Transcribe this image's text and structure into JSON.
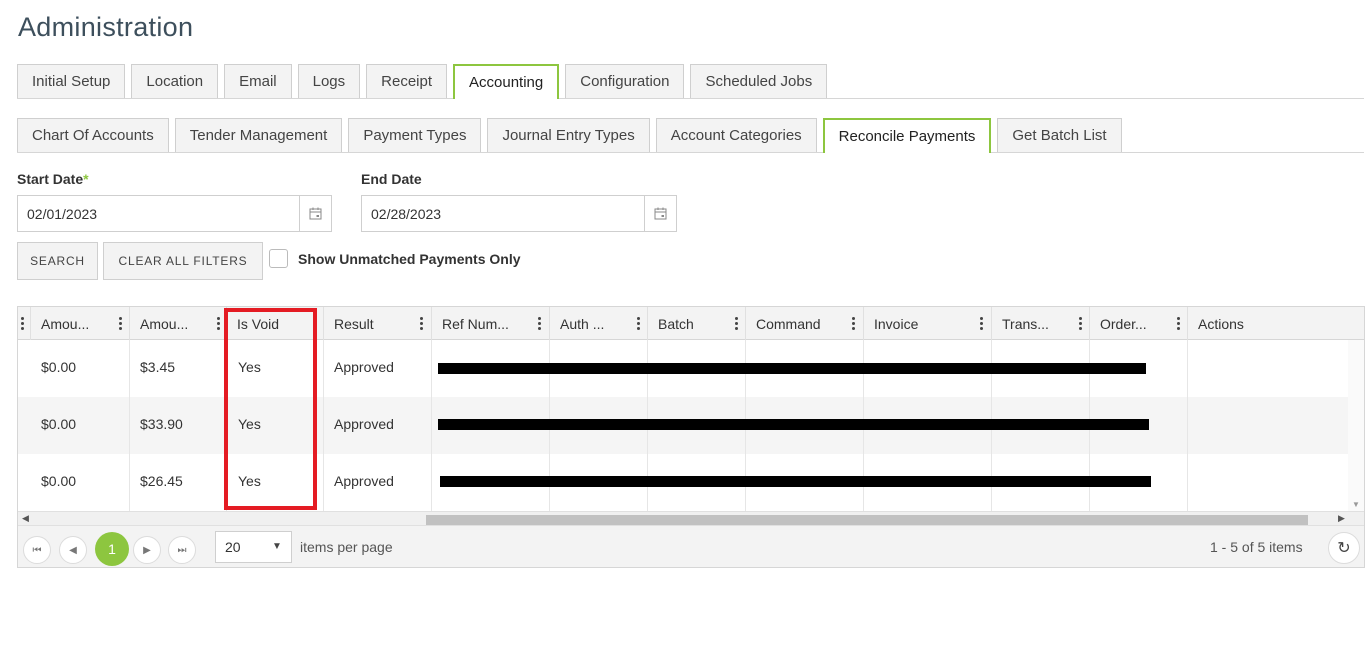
{
  "page": {
    "title": "Administration"
  },
  "main_tabs": [
    {
      "label": "Initial Setup",
      "active": false
    },
    {
      "label": "Location",
      "active": false
    },
    {
      "label": "Email",
      "active": false
    },
    {
      "label": "Logs",
      "active": false
    },
    {
      "label": "Receipt",
      "active": false
    },
    {
      "label": "Accounting",
      "active": true
    },
    {
      "label": "Configuration",
      "active": false
    },
    {
      "label": "Scheduled Jobs",
      "active": false
    }
  ],
  "sub_tabs": [
    {
      "label": "Chart Of Accounts",
      "active": false
    },
    {
      "label": "Tender Management",
      "active": false
    },
    {
      "label": "Payment Types",
      "active": false
    },
    {
      "label": "Journal Entry Types",
      "active": false
    },
    {
      "label": "Account Categories",
      "active": false
    },
    {
      "label": "Reconcile Payments",
      "active": true
    },
    {
      "label": "Get Batch List",
      "active": false
    }
  ],
  "filters": {
    "start_date_label": "Start Date",
    "start_required_mark": "*",
    "start_date_value": "02/01/2023",
    "end_date_label": "End Date",
    "end_date_value": "02/28/2023",
    "search_label": "SEARCH",
    "clear_label": "CLEAR ALL FILTERS",
    "unmatched_label": "Show Unmatched Payments Only",
    "unmatched_checked": false
  },
  "grid": {
    "columns": [
      "Amou...",
      "Amou...",
      "Is Void",
      "Result",
      "Ref Num...",
      "Auth ...",
      "Batch",
      "Command",
      "Invoice",
      "Trans...",
      "Order...",
      "Actions"
    ],
    "rows": [
      {
        "amount1": "$0.00",
        "amount2": "$3.45",
        "is_void": "Yes",
        "result": "Approved"
      },
      {
        "amount1": "$0.00",
        "amount2": "$33.90",
        "is_void": "Yes",
        "result": "Approved"
      },
      {
        "amount1": "$0.00",
        "amount2": "$26.45",
        "is_void": "Yes",
        "result": "Approved"
      }
    ]
  },
  "pager": {
    "current_page": "1",
    "page_size": "20",
    "items_per_page_label": "items per page",
    "info": "1 - 5 of 5 items"
  },
  "colors": {
    "accent": "#8dc63f",
    "highlight": "#e41b23",
    "title": "#3d4f5c"
  }
}
